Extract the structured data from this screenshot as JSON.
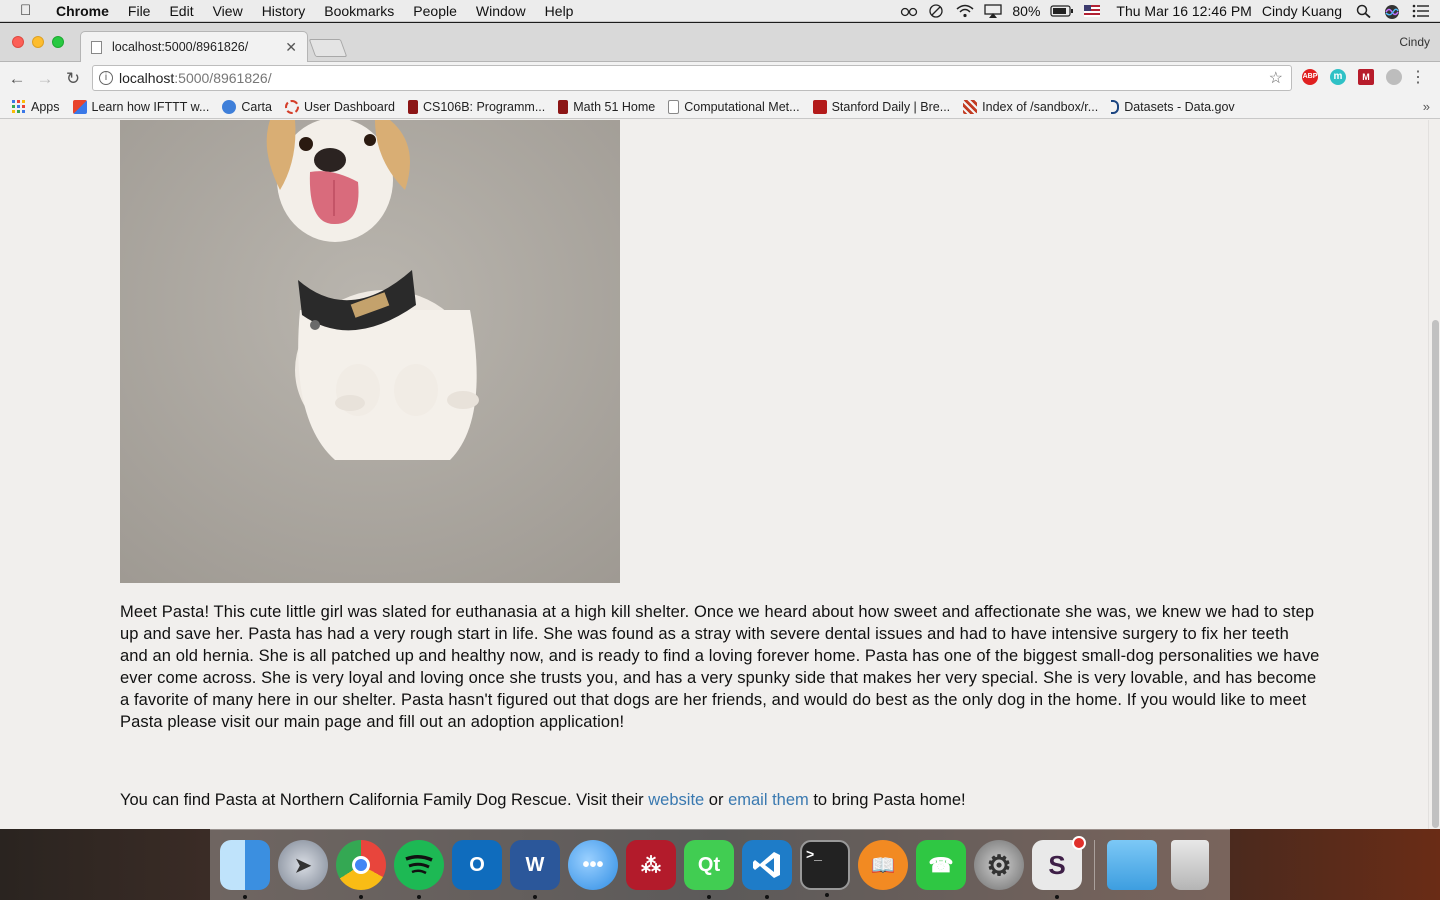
{
  "menubar": {
    "app_name": "Chrome",
    "menus": [
      "File",
      "Edit",
      "View",
      "History",
      "Bookmarks",
      "People",
      "Window",
      "Help"
    ],
    "battery": "80%",
    "datetime": "Thu Mar 16  12:46 PM",
    "user": "Cindy Kuang"
  },
  "browser": {
    "tab_title": "localhost:5000/8961826/",
    "profile_name": "Cindy",
    "url_host": "localhost",
    "url_path": ":5000/8961826/",
    "extensions": [
      "ABP",
      "m",
      "M",
      "shield"
    ]
  },
  "bookmarks": [
    {
      "label": "Apps",
      "icon": "apps-grid-icon",
      "color": "#3b78e7"
    },
    {
      "label": "Learn how IFTTT w...",
      "icon": "ifttt-icon",
      "color": "#e8442b"
    },
    {
      "label": "Carta",
      "icon": "carta-icon",
      "color": "#3f7fd9"
    },
    {
      "label": "User Dashboard",
      "icon": "dashboard-icon",
      "color": "#d43e2a"
    },
    {
      "label": "CS106B: Programm...",
      "icon": "stanford-icon",
      "color": "#8c1515"
    },
    {
      "label": "Math 51 Home",
      "icon": "stanford-icon",
      "color": "#8c1515"
    },
    {
      "label": "Computational Met...",
      "icon": "page-icon",
      "color": "#888888"
    },
    {
      "label": "Stanford Daily | Bre...",
      "icon": "stanford-daily-icon",
      "color": "#b31b1b"
    },
    {
      "label": "Index of /sandbox/r...",
      "icon": "index-icon",
      "color": "#c23b22"
    },
    {
      "label": "Datasets - Data.gov",
      "icon": "datagov-icon",
      "color": "#1a4480"
    }
  ],
  "page": {
    "description": "Meet Pasta! This cute little girl was slated for euthanasia at a high kill shelter. Once we heard about how sweet and affectionate she was, we knew we had to step up and save her. Pasta has had a very rough start in life. She was found as a stray with severe dental issues and had to have intensive surgery to fix her teeth and an old hernia. She is all patched up and healthy now, and is ready to find a loving forever home. Pasta has one of the biggest small-dog personalities we have ever come across. She is very loyal and loving once she trusts you, and has a very spunky side that makes her very special. She is very lovable, and has become a favorite of many here in our shelter. Pasta hasn't figured out that dogs are her friends, and would do best as the only dog in the home. If you would like to meet Pasta please visit our main page and fill out an adoption application!",
    "find_prefix": "You can find Pasta at Northern California Family Dog Rescue. Visit their ",
    "website_link": "website",
    "find_or": " or ",
    "email_link": "email them",
    "find_suffix": " to bring Pasta home!"
  },
  "dock": [
    {
      "name": "finder-icon",
      "label": "",
      "color": "#4aa3e8",
      "running": true
    },
    {
      "name": "launchpad-icon",
      "label": "",
      "color": "#7d8694",
      "running": false
    },
    {
      "name": "chrome-icon",
      "label": "",
      "color": "#e8453c",
      "running": true
    },
    {
      "name": "spotify-icon",
      "label": "",
      "color": "#1db954",
      "running": true
    },
    {
      "name": "outlook-icon",
      "label": "O",
      "color": "#0f6cbd",
      "running": false
    },
    {
      "name": "word-icon",
      "label": "W",
      "color": "#2b579a",
      "running": true
    },
    {
      "name": "messages-icon",
      "label": "",
      "color": "#55a8f5",
      "running": false
    },
    {
      "name": "mendeley-icon",
      "label": "",
      "color": "#b31b2b",
      "running": false
    },
    {
      "name": "qt-icon",
      "label": "Qt",
      "color": "#41cd52",
      "running": true
    },
    {
      "name": "vscode-icon",
      "label": "",
      "color": "#1e7cc8",
      "running": true
    },
    {
      "name": "terminal-icon",
      "label": ">_",
      "color": "#222222",
      "running": true
    },
    {
      "name": "ibooks-icon",
      "label": "",
      "color": "#f28a22",
      "running": false
    },
    {
      "name": "facetime-icon",
      "label": "",
      "color": "#2fc743",
      "running": false
    },
    {
      "name": "system-preferences-icon",
      "label": "",
      "color": "#8a8a8a",
      "running": false
    },
    {
      "name": "slack-icon",
      "label": "S",
      "color": "#e9e9e9",
      "running": true
    }
  ]
}
